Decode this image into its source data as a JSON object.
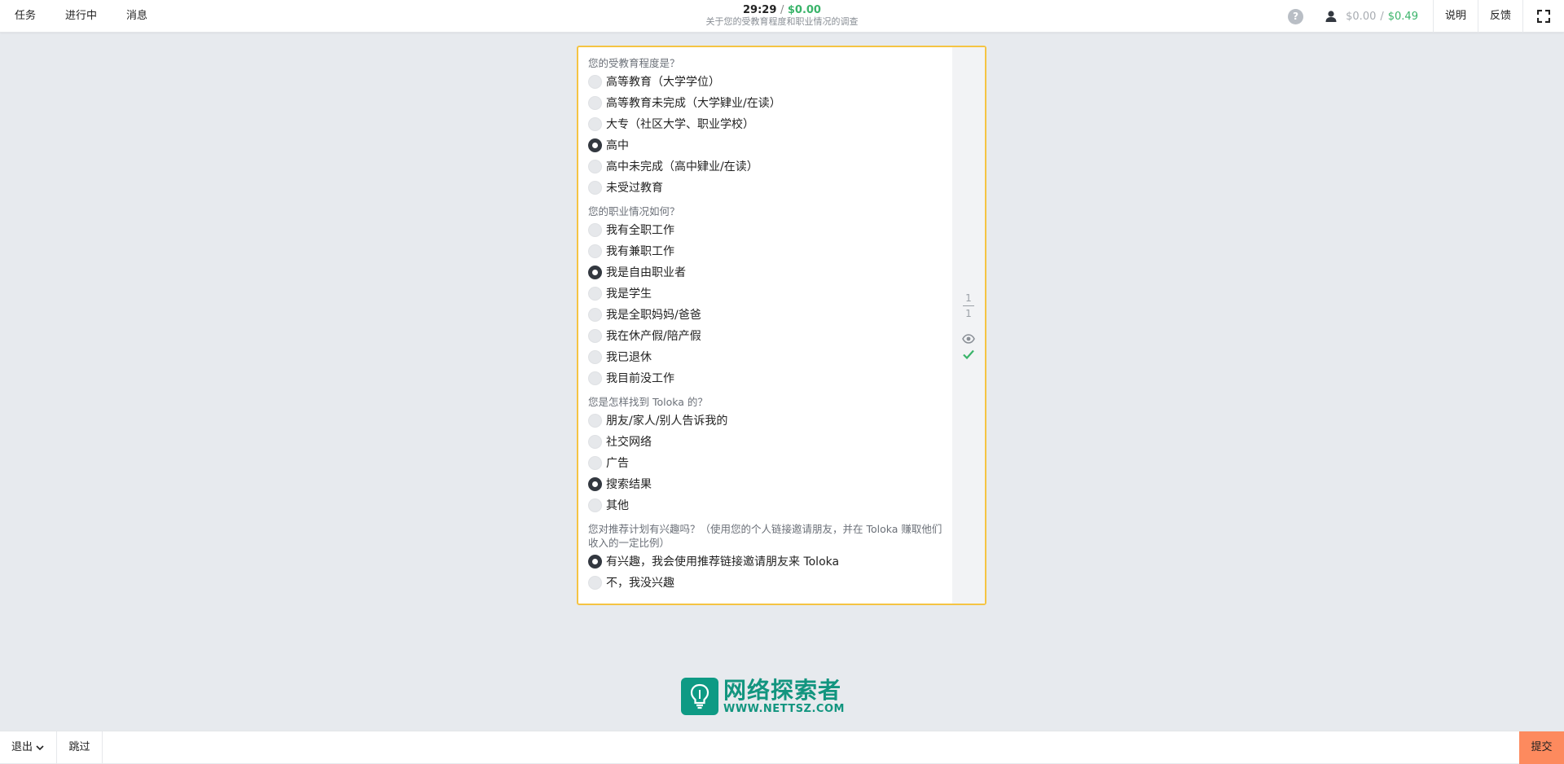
{
  "nav": {
    "tasks": "任务",
    "in_progress": "进行中",
    "messages": "消息"
  },
  "header": {
    "timer": "29:29",
    "separator": "/",
    "reward": "$0.00",
    "subtitle": "关于您的受教育程度和职业情况的调查"
  },
  "right_nav": {
    "help_icon": "question-circle",
    "balance_icon": "user-icon",
    "balance_grey": "$0.00",
    "balance_sep": "/",
    "balance_green": "$0.49",
    "instructions": "说明",
    "feedback": "反馈",
    "fullscreen_icon": "expand"
  },
  "form": {
    "questions": [
      {
        "title": "您的受教育程度是？",
        "options": [
          {
            "label": "高等教育（大学学位）",
            "checked": false
          },
          {
            "label": "高等教育未完成（大学肄业/在读）",
            "checked": false
          },
          {
            "label": "大专（社区大学、职业学校）",
            "checked": false
          },
          {
            "label": "高中",
            "checked": true
          },
          {
            "label": "高中未完成（高中肄业/在读）",
            "checked": false
          },
          {
            "label": "未受过教育",
            "checked": false
          }
        ]
      },
      {
        "title": "您的职业情况如何？",
        "options": [
          {
            "label": "我有全职工作",
            "checked": false
          },
          {
            "label": "我有兼职工作",
            "checked": false
          },
          {
            "label": "我是自由职业者",
            "checked": true
          },
          {
            "label": "我是学生",
            "checked": false
          },
          {
            "label": "我是全职妈妈/爸爸",
            "checked": false
          },
          {
            "label": "我在休产假/陪产假",
            "checked": false
          },
          {
            "label": "我已退休",
            "checked": false
          },
          {
            "label": "我目前没工作",
            "checked": false
          }
        ]
      },
      {
        "title": "您是怎样找到 Toloka 的？",
        "options": [
          {
            "label": "朋友/家人/别人告诉我的",
            "checked": false
          },
          {
            "label": "社交网络",
            "checked": false
          },
          {
            "label": "广告",
            "checked": false
          },
          {
            "label": "搜索结果",
            "checked": true
          },
          {
            "label": "其他",
            "checked": false
          }
        ]
      },
      {
        "title": "您对推荐计划有兴趣吗？（使用您的个人链接邀请朋友，并在 Toloka 赚取他们收入的一定比例）",
        "options": [
          {
            "label": "有兴趣，我会使用推荐链接邀请朋友来 Toloka",
            "checked": true
          },
          {
            "label": "不，我没兴趣",
            "checked": false
          }
        ]
      }
    ]
  },
  "side": {
    "page_current": "1",
    "page_total": "1",
    "eye_icon": "eye",
    "check_icon": "checkmark",
    "check_color": "#3ab46a"
  },
  "watermark": {
    "cn": "网络探索者",
    "url": "WWW.NETTSZ.COM"
  },
  "bottom": {
    "exit": "退出",
    "skip": "跳过",
    "submit": "提交"
  },
  "colors": {
    "accent_border": "#f5c443",
    "submit_bg": "#fd8a5e",
    "money_green": "#3ab46a",
    "logo_teal": "#0e9a84"
  }
}
